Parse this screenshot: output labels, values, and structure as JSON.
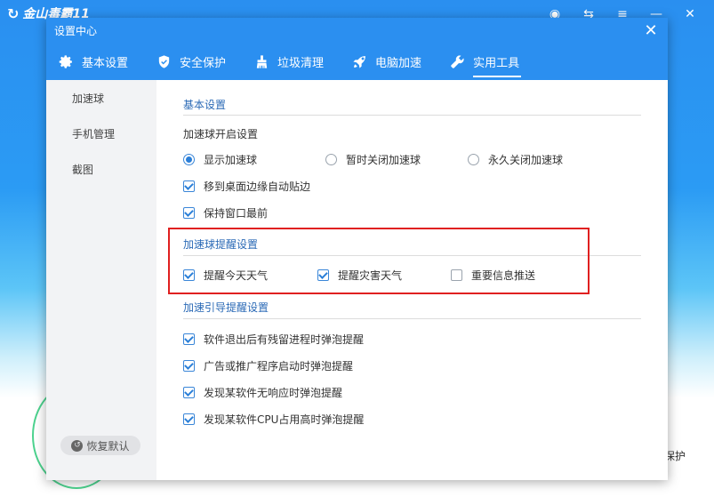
{
  "bg_app": {
    "title": "金山毒霸11",
    "logo_glyph": "↻",
    "controls": [
      "◉",
      "⇆",
      "≡",
      "—",
      "✕"
    ],
    "right_text": "保护"
  },
  "dialog": {
    "title": "设置中心",
    "close_label": "✕",
    "tabs": [
      {
        "label": "基本设置",
        "icon": "gear-icon"
      },
      {
        "label": "安全保护",
        "icon": "shield-icon"
      },
      {
        "label": "垃圾清理",
        "icon": "broom-icon"
      },
      {
        "label": "电脑加速",
        "icon": "rocket-icon"
      },
      {
        "label": "实用工具",
        "icon": "wrench-icon",
        "active": true
      }
    ],
    "sidebar": {
      "items": [
        "加速球",
        "手机管理",
        "截图"
      ],
      "restore_label": "恢复默认",
      "restore_icon": "↺"
    },
    "sections": {
      "basic": {
        "title": "基本设置",
        "open_label": "加速球开启设置",
        "radios": [
          {
            "label": "显示加速球",
            "checked": true
          },
          {
            "label": "暂时关闭加速球",
            "checked": false
          },
          {
            "label": "永久关闭加速球",
            "checked": false
          }
        ],
        "checkboxes": [
          {
            "label": "移到桌面边缘自动贴边",
            "checked": true
          },
          {
            "label": "保持窗口最前",
            "checked": true
          }
        ]
      },
      "reminder": {
        "title": "加速球提醒设置",
        "checkboxes": [
          {
            "label": "提醒今天天气",
            "checked": true
          },
          {
            "label": "提醒灾害天气",
            "checked": true
          },
          {
            "label": "重要信息推送",
            "checked": false
          }
        ]
      },
      "guide": {
        "title": "加速引导提醒设置",
        "checkboxes": [
          {
            "label": "软件退出后有残留进程时弹泡提醒",
            "checked": true
          },
          {
            "label": "广告或推广程序启动时弹泡提醒",
            "checked": true
          },
          {
            "label": "发现某软件无响应时弹泡提醒",
            "checked": true
          },
          {
            "label": "发现某软件CPU占用高时弹泡提醒",
            "checked": true
          }
        ]
      }
    }
  },
  "colors": {
    "header_blue": "#2b8ff0",
    "accent_blue": "#2b7fd8",
    "section_title": "#2b6ab6",
    "highlight_red": "#e02020"
  }
}
